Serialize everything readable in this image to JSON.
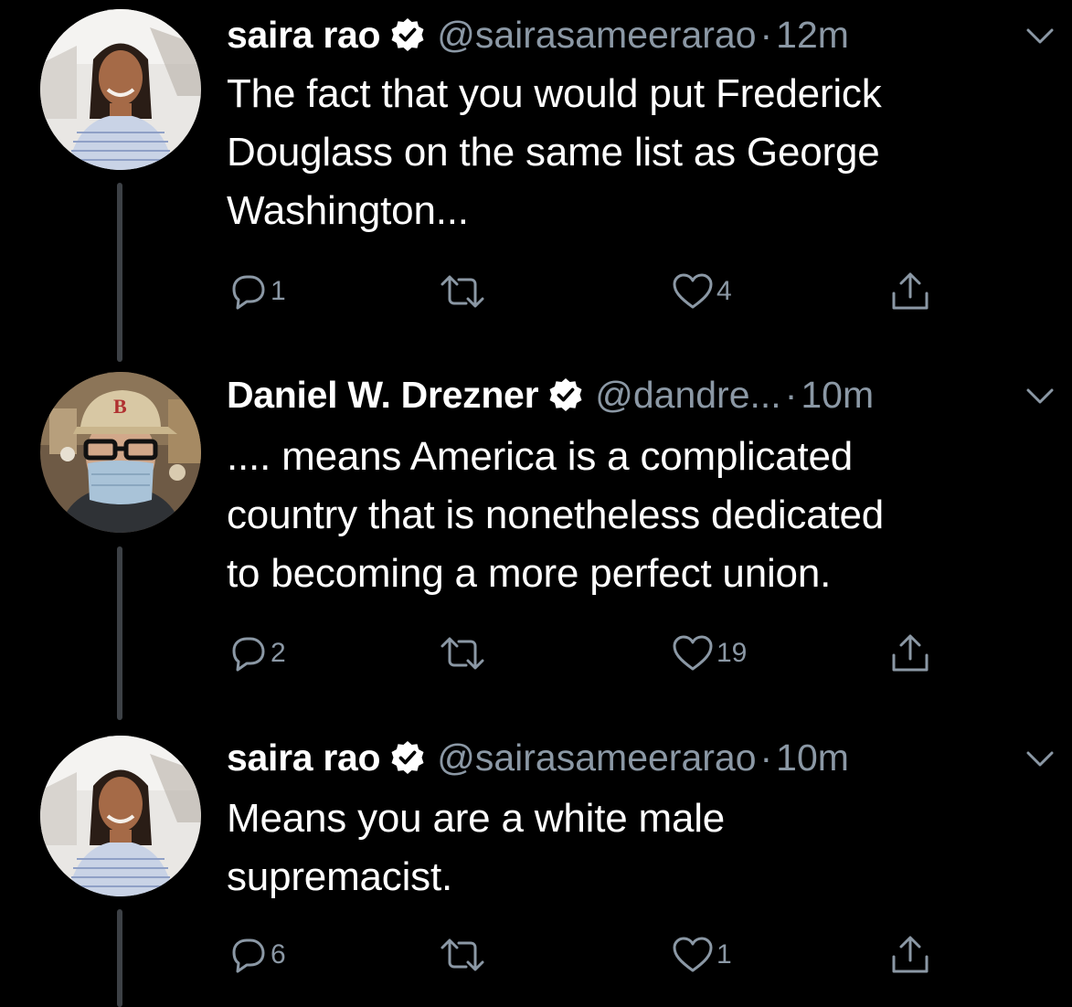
{
  "tweets": [
    {
      "name": "saira rao",
      "handle": "@sairasameerarao",
      "separator": "·",
      "time": "12m",
      "text_lines": [
        "The fact that you would put Frederick",
        "Douglass on the same list as George",
        "Washington..."
      ],
      "reply_count": "1",
      "like_count": "4",
      "verified": true
    },
    {
      "name": "Daniel W. Drezner",
      "handle": "@dandre...",
      "separator": "·",
      "time": "10m",
      "text_lines": [
        ".... means America is a complicated",
        "country that is nonetheless dedicated",
        "to becoming a more perfect union."
      ],
      "reply_count": "2",
      "like_count": "19",
      "verified": true
    },
    {
      "name": "saira rao",
      "handle": "@sairasameerarao",
      "separator": "·",
      "time": "10m",
      "text_lines": [
        "Means you are a white male",
        "supremacist."
      ],
      "reply_count": "6",
      "like_count": "1",
      "verified": true
    }
  ],
  "icons": {
    "reply": "reply-icon",
    "retweet": "retweet-icon",
    "like": "heart-icon",
    "share": "share-icon",
    "verified": "verified-badge-icon",
    "more": "chevron-down-icon"
  },
  "colors": {
    "background": "#000000",
    "text": "#ffffff",
    "secondary": "#8b98a5",
    "thread_line": "#3d4146"
  }
}
